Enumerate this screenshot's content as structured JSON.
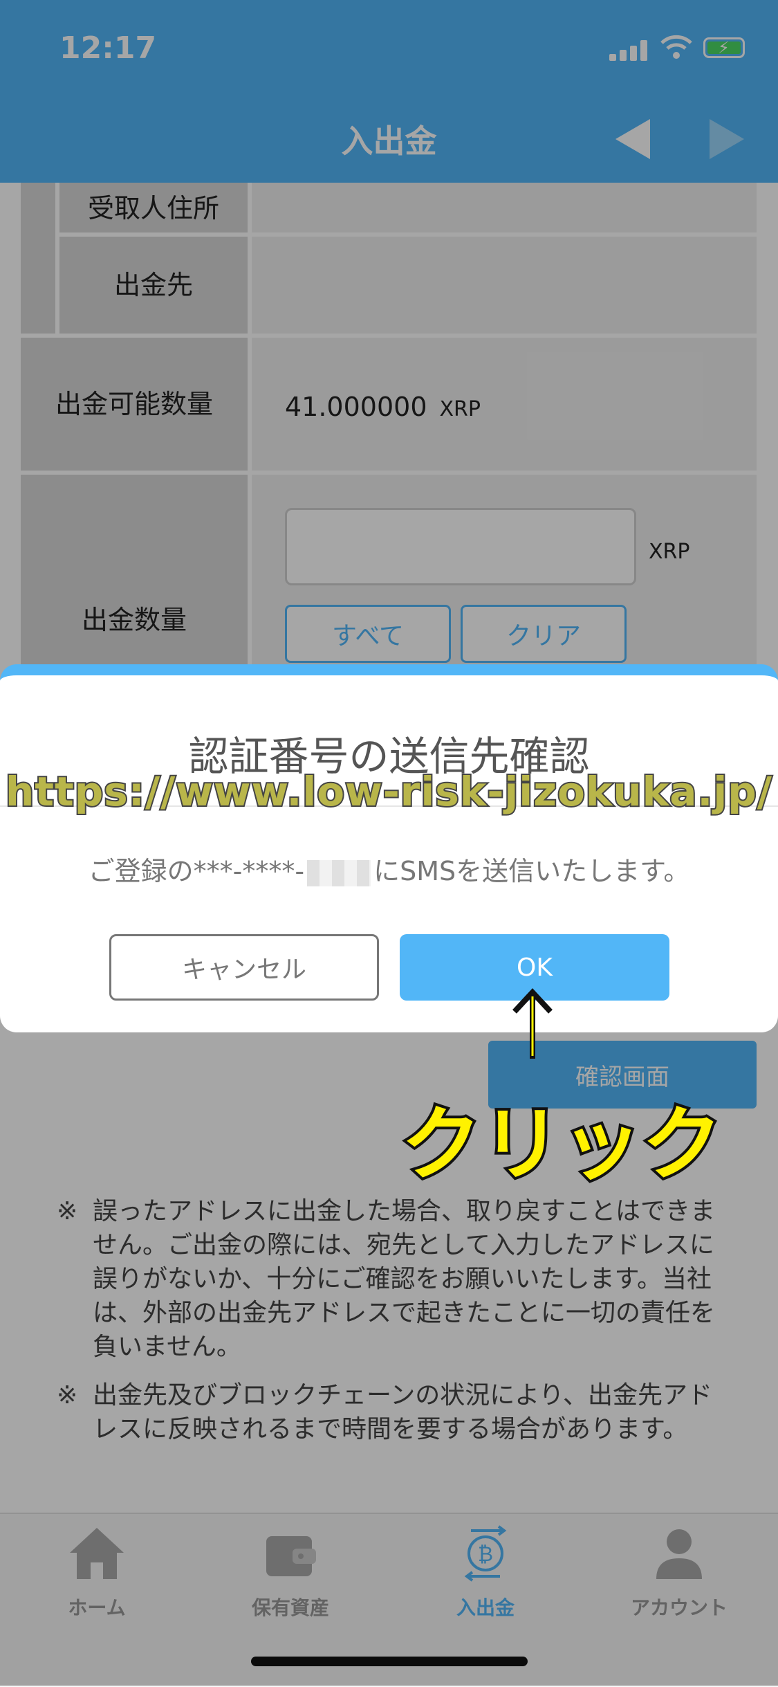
{
  "status_bar": {
    "time": "12:17"
  },
  "nav": {
    "title": "入出金"
  },
  "form": {
    "row_address_label": "受取人住所",
    "row_dest_label": "出金先",
    "row_available_label": "出金可能数量",
    "available_amount": "41.000000",
    "available_unit": "XRP",
    "row_qty_label": "出金数量",
    "qty_value": "",
    "qty_unit": "XRP",
    "all_button": "すべて",
    "clear_button": "クリア",
    "confirm_button": "確認画面"
  },
  "notes": [
    {
      "mark": "※",
      "text": "誤ったアドレスに出金した場合、取り戻すことはできません。ご出金の際には、宛先として入力したアドレスに誤りがないか、十分にご確認をお願いいたします。当社は、外部の出金先アドレスで起きたことに一切の責任を負いません。"
    },
    {
      "mark": "※",
      "text": "出金先及びブロックチェーンの状況により、出金先アドレスに反映されるまで時間を要する場合があります。"
    }
  ],
  "dialog": {
    "title": "認証番号の送信先確認",
    "message_prefix": "ご登録の***-****-",
    "message_suffix": "にSMSを送信いたします。",
    "cancel_button": "キャンセル",
    "ok_button": "OK"
  },
  "annotation": {
    "watermark": "https://www.low-risk-jizokuka.jp/",
    "arrow": "↑",
    "click_label": "クリック"
  },
  "tabbar": {
    "items": [
      {
        "label": "ホーム",
        "icon": "home-icon",
        "active": false
      },
      {
        "label": "保有資産",
        "icon": "wallet-icon",
        "active": false
      },
      {
        "label": "入出金",
        "icon": "bitcoin-transfer-icon",
        "active": true
      },
      {
        "label": "アカウント",
        "icon": "account-icon",
        "active": false
      }
    ]
  },
  "colors": {
    "accent": "#52b6f7",
    "annotation_yellow": "#fff200"
  }
}
